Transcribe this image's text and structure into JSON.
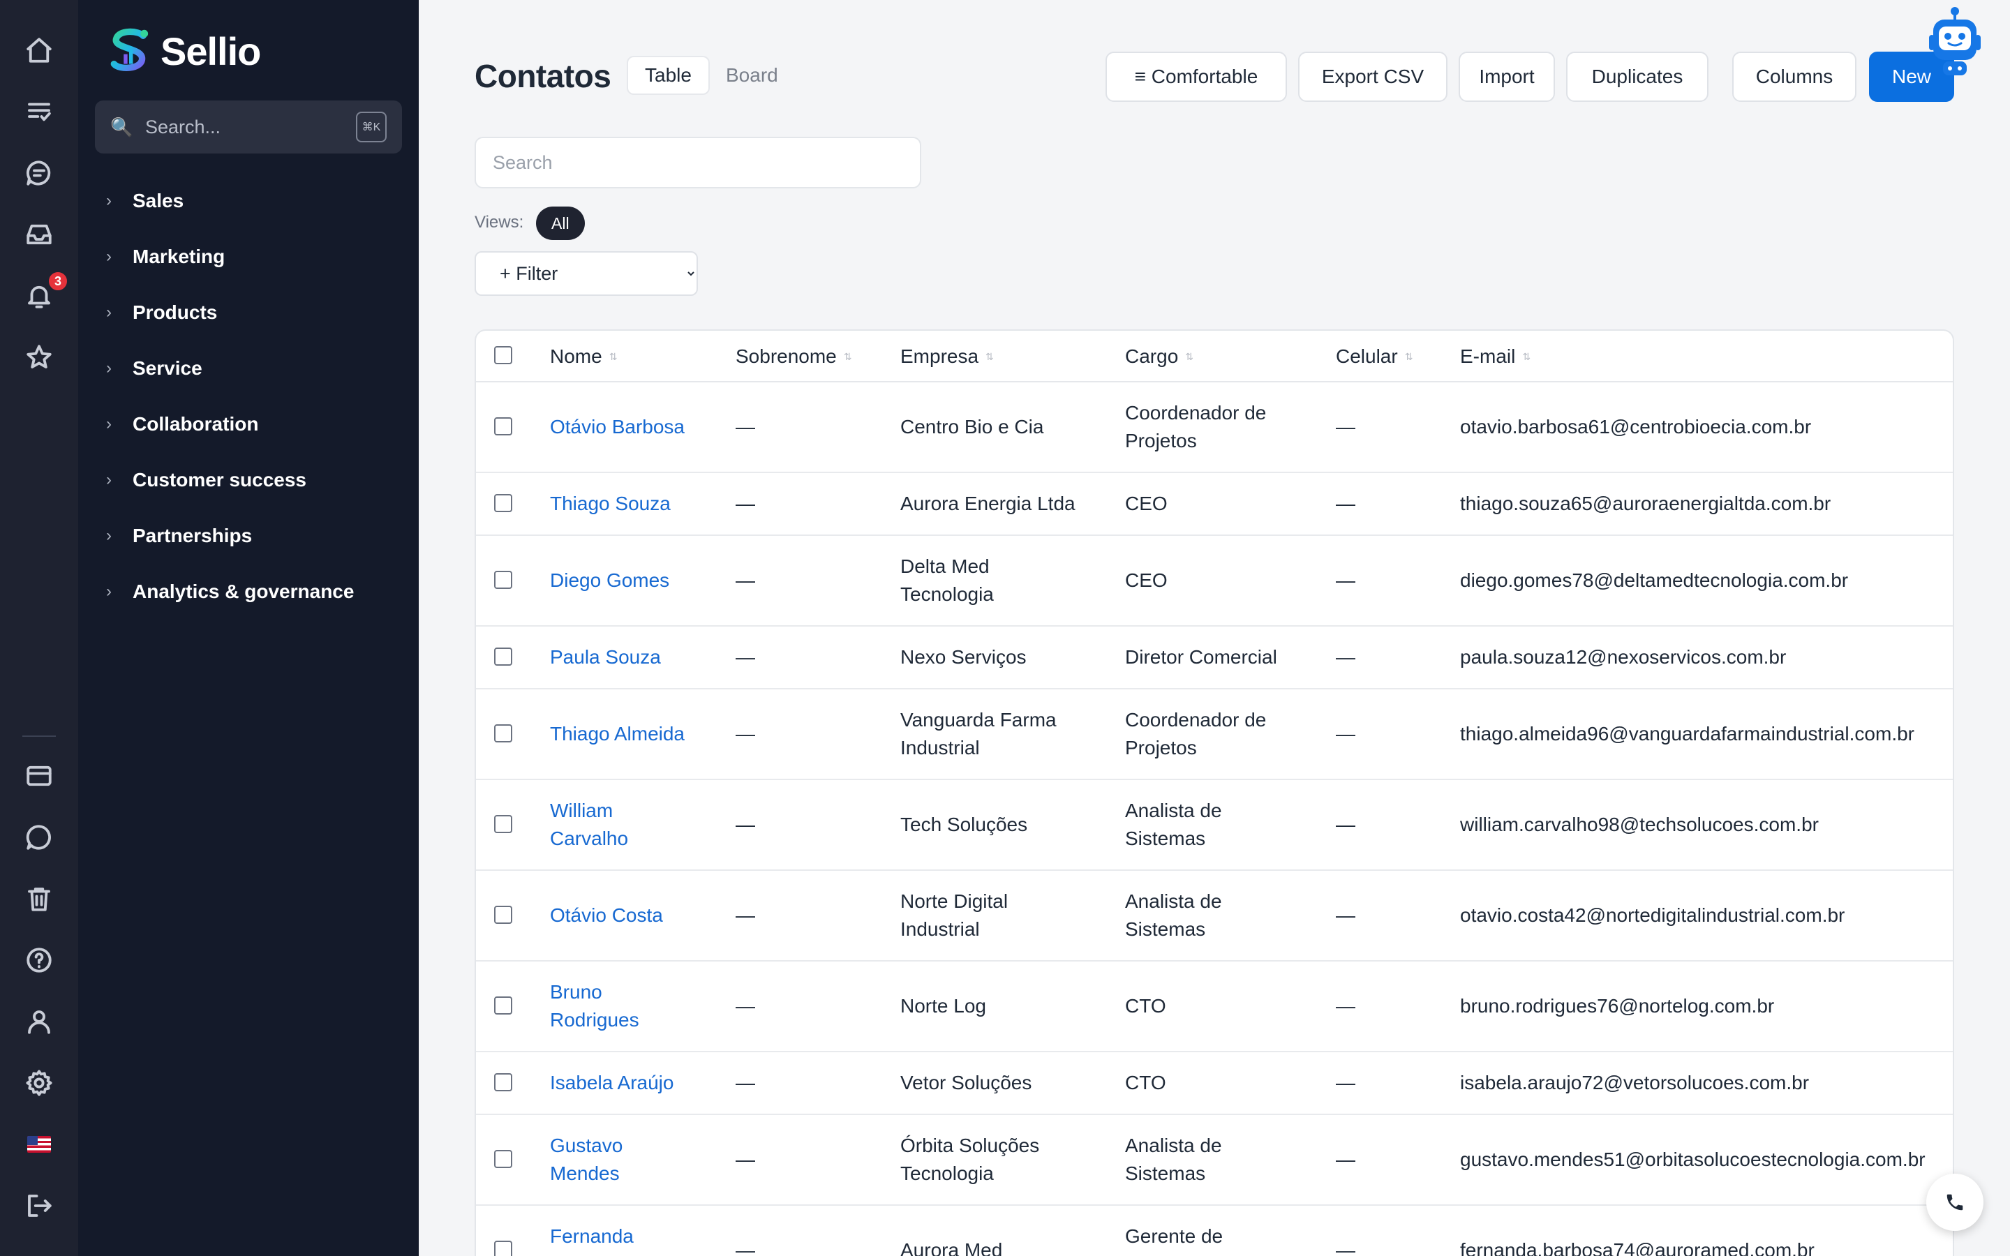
{
  "app": {
    "brand": "Sellio"
  },
  "rail": {
    "notification_count": "3",
    "kbd_hint": "⌘K"
  },
  "sidebar": {
    "search_placeholder": "Search...",
    "items": [
      {
        "label": "Sales"
      },
      {
        "label": "Marketing"
      },
      {
        "label": "Products"
      },
      {
        "label": "Service"
      },
      {
        "label": "Collaboration"
      },
      {
        "label": "Customer success"
      },
      {
        "label": "Partnerships"
      },
      {
        "label": "Analytics & governance"
      }
    ]
  },
  "main": {
    "title": "Contatos",
    "tabs": {
      "table": "Table",
      "board": "Board"
    },
    "toolbar": {
      "density": "≡ Comfortable",
      "export": "Export CSV",
      "import": "Import",
      "duplicates": "Duplicates",
      "columns": "Columns",
      "new": "New"
    },
    "search_placeholder": "Search",
    "views_label": "Views:",
    "views_all": "All",
    "filter_label": "+ Filter"
  },
  "table": {
    "columns": [
      "Nome",
      "Sobrenome",
      "Empresa",
      "Cargo",
      "Celular",
      "E-mail"
    ],
    "rows": [
      {
        "nome": "Otávio Barbosa",
        "sobrenome": "—",
        "empresa": "Centro Bio e Cia",
        "cargo": "Coordenador de Projetos",
        "celular": "—",
        "email": "otavio.barbosa61@centrobioecia.com.br"
      },
      {
        "nome": "Thiago Souza",
        "sobrenome": "—",
        "empresa": "Aurora Energia Ltda",
        "cargo": "CEO",
        "celular": "—",
        "email": "thiago.souza65@auroraenergialtda.com.br"
      },
      {
        "nome": "Diego Gomes",
        "sobrenome": "—",
        "empresa": "Delta Med Tecnologia",
        "cargo": "CEO",
        "celular": "—",
        "email": "diego.gomes78@deltamedtecnologia.com.br"
      },
      {
        "nome": "Paula Souza",
        "sobrenome": "—",
        "empresa": "Nexo Serviços",
        "cargo": "Diretor Comercial",
        "celular": "—",
        "email": "paula.souza12@nexoservicos.com.br"
      },
      {
        "nome": "Thiago Almeida",
        "sobrenome": "—",
        "empresa": "Vanguarda Farma Industrial",
        "cargo": "Coordenador de Projetos",
        "celular": "—",
        "email": "thiago.almeida96@vanguardafarmaindustrial.com.br"
      },
      {
        "nome": "William Carvalho",
        "sobrenome": "—",
        "empresa": "Tech Soluções",
        "cargo": "Analista de Sistemas",
        "celular": "—",
        "email": "william.carvalho98@techsolucoes.com.br"
      },
      {
        "nome": "Otávio Costa",
        "sobrenome": "—",
        "empresa": "Norte Digital Industrial",
        "cargo": "Analista de Sistemas",
        "celular": "—",
        "email": "otavio.costa42@nortedigitalindustrial.com.br"
      },
      {
        "nome": "Bruno Rodrigues",
        "sobrenome": "—",
        "empresa": "Norte Log",
        "cargo": "CTO",
        "celular": "—",
        "email": "bruno.rodrigues76@nortelog.com.br"
      },
      {
        "nome": "Isabela Araújo",
        "sobrenome": "—",
        "empresa": "Vetor Soluções",
        "cargo": "CTO",
        "celular": "—",
        "email": "isabela.araujo72@vetorsolucoes.com.br"
      },
      {
        "nome": "Gustavo Mendes",
        "sobrenome": "—",
        "empresa": "Órbita Soluções Tecnologia",
        "cargo": "Analista de Sistemas",
        "celular": "—",
        "email": "gustavo.mendes51@orbitasolucoestecnologia.com.br"
      },
      {
        "nome": "Fernanda Barbosa",
        "sobrenome": "—",
        "empresa": "Aurora Med",
        "cargo": "Gerente de Vendas",
        "celular": "—",
        "email": "fernanda.barbosa74@auroramed.com.br"
      }
    ]
  },
  "colors": {
    "accent": "#0b6fe0",
    "link": "#1769d1",
    "rail": "#1e2230",
    "sidebar": "#141a2a",
    "badge": "#e5323b"
  }
}
